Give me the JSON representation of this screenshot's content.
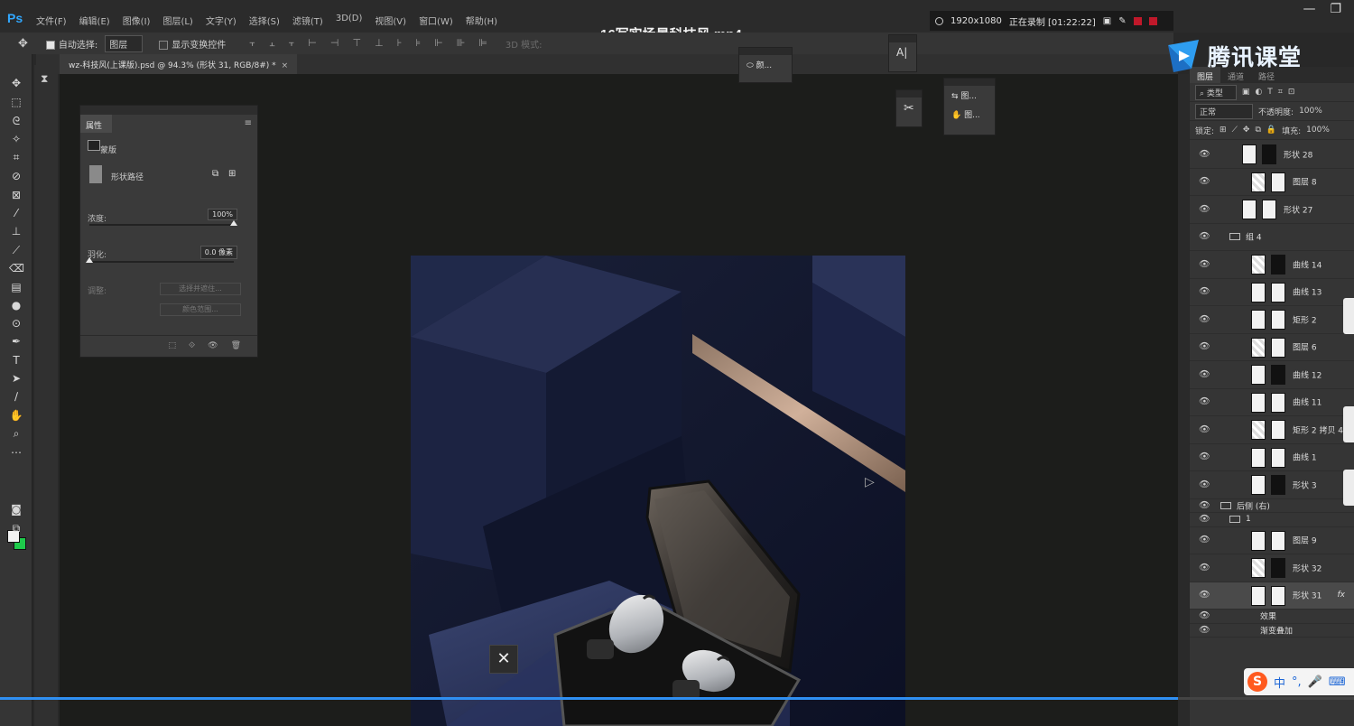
{
  "app": {
    "logo": "Ps",
    "menu": [
      "文件(F)",
      "编辑(E)",
      "图像(I)",
      "图层(L)",
      "文字(Y)",
      "选择(S)",
      "滤镜(T)",
      "3D(D)",
      "视图(V)",
      "窗口(W)",
      "帮助(H)"
    ]
  },
  "video": {
    "title": "16写实场景科技风.mp4",
    "progress": 0.87,
    "close_glyph": "✕"
  },
  "recorder": {
    "resolution": "1920x1080",
    "status": "正在录制 [01:22:22]"
  },
  "options_bar": {
    "auto_select_label": "自动选择:",
    "auto_select_value": "图层",
    "show_transform_label": "显示变换控件",
    "mode_3d": "3D 模式:"
  },
  "document": {
    "tab_title": "wz-科技风(上课版).psd @ 94.3% (形状 31, RGB/8#) *",
    "close": "×"
  },
  "properties_panel": {
    "tab": "属性",
    "mask_label": "蒙版",
    "path_label": "形状路径",
    "density_label": "浓度:",
    "density_value": "100%",
    "density": 1.0,
    "feather_label": "羽化:",
    "feather_value": "0.0 像素",
    "feather": 0.0,
    "adjust_label": "调整:",
    "select_and_mask": "选择并遮住...",
    "color_range": "颜色范围..."
  },
  "mini_panels": {
    "panel1": "颜...",
    "panel2": "A|",
    "panel4_row1": "图...",
    "panel4_row2": "图..."
  },
  "brand": {
    "text": "腾讯课堂"
  },
  "layers_panel": {
    "tabs": [
      "图层",
      "通道",
      "路径"
    ],
    "filter_kind": "类型",
    "blend_mode": "正常",
    "opacity_label": "不透明度:",
    "opacity_value": "100%",
    "lock_label": "锁定:",
    "fill_label": "填充:",
    "fill_value": "100%",
    "layers": [
      {
        "name": "形状 28",
        "indent": 1
      },
      {
        "name": "图层 8",
        "indent": 2
      },
      {
        "name": "形状 27",
        "indent": 1
      },
      {
        "name": "组 4",
        "indent": 1,
        "folder": true
      },
      {
        "name": "曲线 14",
        "indent": 2
      },
      {
        "name": "曲线 13",
        "indent": 2
      },
      {
        "name": "矩形 2",
        "indent": 2
      },
      {
        "name": "图层 6",
        "indent": 2
      },
      {
        "name": "曲线 12",
        "indent": 2
      },
      {
        "name": "曲线 11",
        "indent": 2
      },
      {
        "name": "矩形 2 拷贝 4",
        "indent": 2
      },
      {
        "name": "曲线 1",
        "indent": 2
      },
      {
        "name": "形状 3",
        "indent": 2
      },
      {
        "name": "后侧 (右)",
        "indent": 0,
        "folder": true,
        "small": true
      },
      {
        "name": "1",
        "indent": 1,
        "folder": true,
        "small": true
      },
      {
        "name": "图层 9",
        "indent": 2
      },
      {
        "name": "形状 32",
        "indent": 2
      },
      {
        "name": "形状 31",
        "indent": 2,
        "selected": true,
        "fx": "fx"
      },
      {
        "name": "效果",
        "indent": 3,
        "small": true
      },
      {
        "name": "渐变叠加",
        "indent": 3,
        "small": true
      }
    ]
  },
  "ime": {
    "logo": "S",
    "lang": "中"
  }
}
